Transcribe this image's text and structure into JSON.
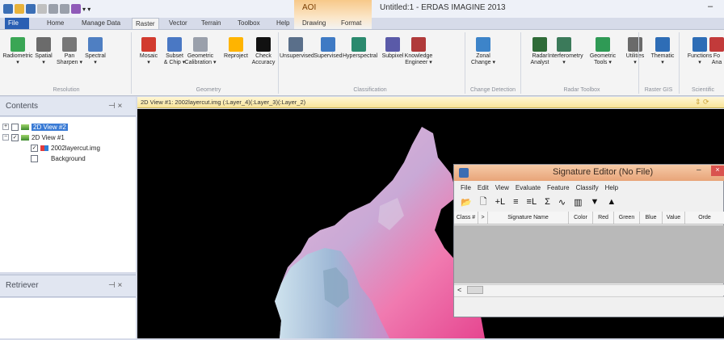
{
  "window": {
    "title": "Untitled:1 - ERDAS IMAGINE 2013",
    "context_tab_group": "AOI",
    "minimize": "–"
  },
  "tabs": [
    "File",
    "Home",
    "Manage Data",
    "Raster",
    "Vector",
    "Terrain",
    "Toolbox",
    "Help",
    "Drawing",
    "Format"
  ],
  "ribbon": {
    "buttons": [
      {
        "label": "Radiometric",
        "sub": "▾",
        "color": "#3aa655"
      },
      {
        "label": "Spatial",
        "sub": "▾",
        "color": "#6b6b6b"
      },
      {
        "label": "Pan",
        "sub": "Sharpen ▾",
        "color": "#777"
      },
      {
        "label": "Spectral",
        "sub": "▾",
        "color": "#4f7fc2"
      },
      {
        "label": "Mosaic",
        "sub": "▾",
        "color": "#d23b2f"
      },
      {
        "label": "Subset",
        "sub": "& Chip ▾",
        "color": "#4a78c4"
      },
      {
        "label": "Geometric",
        "sub": "Calibration ▾",
        "color": "#9aa0ab"
      },
      {
        "label": "Reproject",
        "sub": "",
        "color": "#ffb400"
      },
      {
        "label": "Check",
        "sub": "Accuracy",
        "color": "#111"
      },
      {
        "label": "Unsupervised",
        "sub": "",
        "color": "#5a6f8a"
      },
      {
        "label": "Supervised",
        "sub": "",
        "color": "#3f7ac4"
      },
      {
        "label": "Hyperspectral",
        "sub": "",
        "color": "#2b8a6e"
      },
      {
        "label": "Subpixel",
        "sub": "",
        "color": "#5a5aa8"
      },
      {
        "label": "Knowledge",
        "sub": "Engineer ▾",
        "color": "#b03a3a"
      },
      {
        "label": "Zonal",
        "sub": "Change ▾",
        "color": "#3d84c9"
      },
      {
        "label": "Radar",
        "sub": "Analyst",
        "color": "#2f6b38"
      },
      {
        "label": "Interferometry",
        "sub": "▾",
        "color": "#3b7a5a"
      },
      {
        "label": "Geometric",
        "sub": "Tools ▾",
        "color": "#2f9a55"
      },
      {
        "label": "Utilities",
        "sub": "▾",
        "color": "#6a6a6a"
      },
      {
        "label": "Thematic",
        "sub": "▾",
        "color": "#2e6db6"
      },
      {
        "label": "Functions",
        "sub": "▾",
        "color": "#2e6db6"
      },
      {
        "label": "Fo",
        "sub": "Ana",
        "color": "#c23a3a"
      }
    ],
    "groups": [
      "Resolution",
      "Geometry",
      "Classification",
      "Change Detection",
      "Radar Toolbox",
      "Raster GIS",
      "Scientific"
    ]
  },
  "contents": {
    "title": "Contents",
    "controls": "⊣ ×",
    "tree": [
      {
        "expander": "+",
        "checked": false,
        "label": "2D View #2",
        "selected": true,
        "icon": "view-icon"
      },
      {
        "expander": "−",
        "checked": true,
        "label": "2D View #1",
        "selected": false,
        "icon": "view-icon"
      },
      {
        "expander": "",
        "checked": true,
        "label": "2002layercut.img",
        "selected": false,
        "icon": "raster-layer-icon"
      },
      {
        "expander": "",
        "checked": false,
        "label": "Background",
        "selected": false,
        "icon": "background-icon"
      }
    ]
  },
  "retriever": {
    "title": "Retriever",
    "controls": "⊣ ×"
  },
  "view": {
    "title": "2D View #1: 2002layercut.img (:Layer_4)(:Layer_3)(:Layer_2)",
    "icons": "⇕ ⟳"
  },
  "signature_editor": {
    "title": "Signature Editor (No File)",
    "min": "–",
    "close": "×",
    "menu": [
      "File",
      "Edit",
      "View",
      "Evaluate",
      "Feature",
      "Classify",
      "Help"
    ],
    "tools": [
      "📂",
      "🗋",
      "+L",
      "≡",
      "≡L",
      "Σ",
      "∿",
      "▥",
      "▼",
      "▲"
    ],
    "columns": [
      "Class #",
      ">",
      "Signature Name",
      "Color",
      "Red",
      "Green",
      "Blue",
      "Value",
      "Orde"
    ],
    "scroll_left": "<"
  }
}
